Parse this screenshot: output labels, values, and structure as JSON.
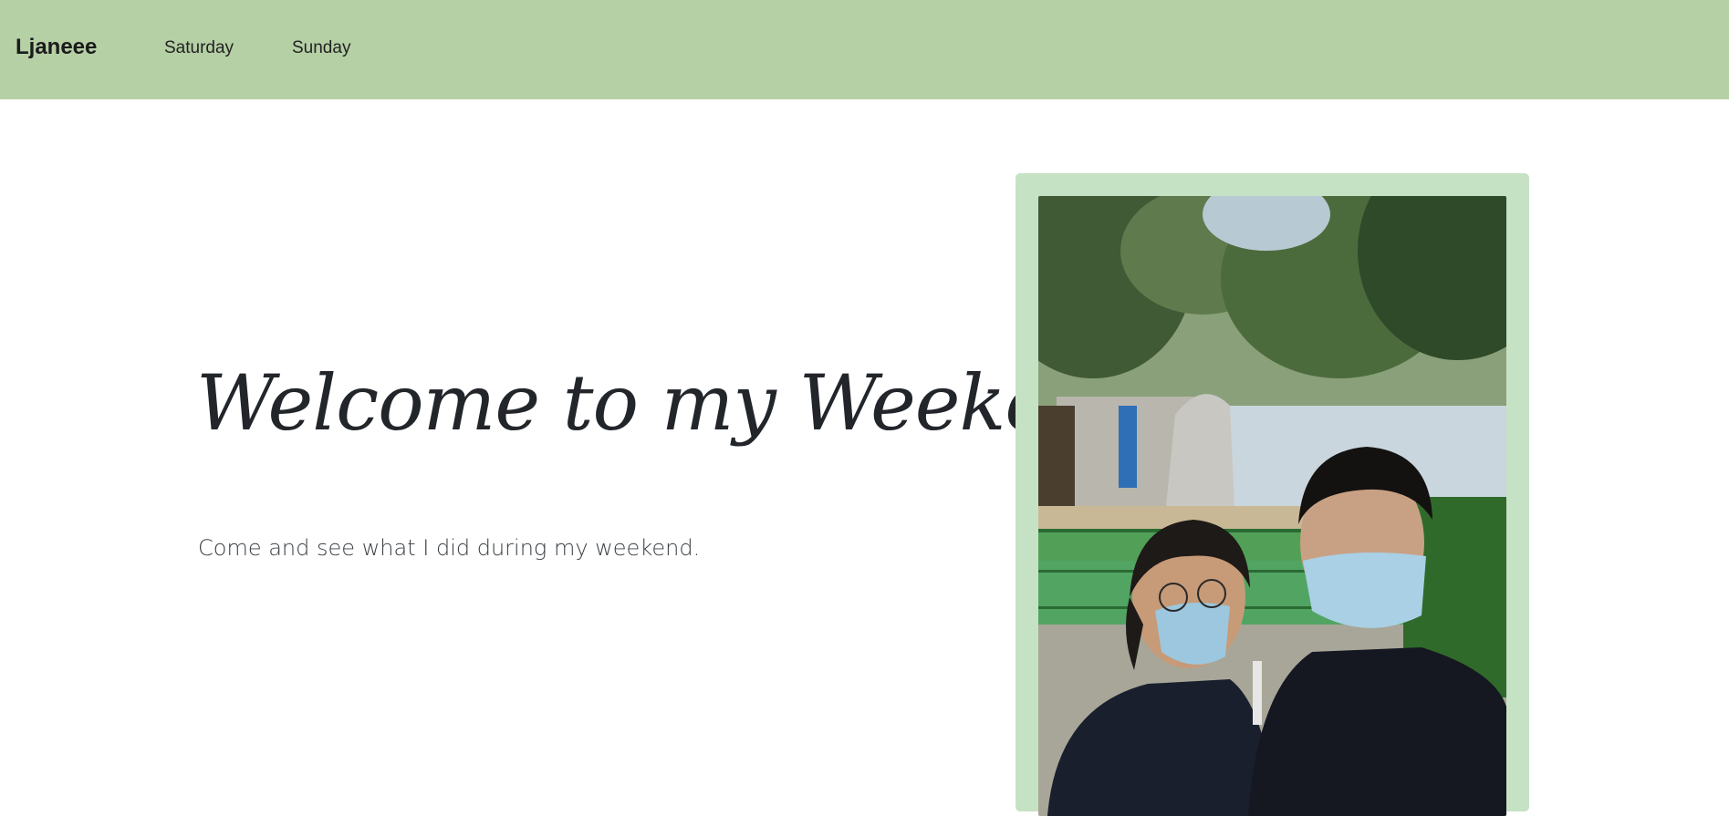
{
  "nav": {
    "brand": "Ljaneee",
    "links": [
      "Saturday",
      "Sunday"
    ]
  },
  "hero": {
    "title": "Welcome to my Weekend",
    "subtitle": "Come and see what I did during my weekend."
  },
  "photo": {
    "alt": "Selfie of two people wearing face masks at a zoo"
  },
  "colors": {
    "navbar": "#b5d0a5",
    "frame": "#c6e2c4",
    "title": "#22262b"
  }
}
